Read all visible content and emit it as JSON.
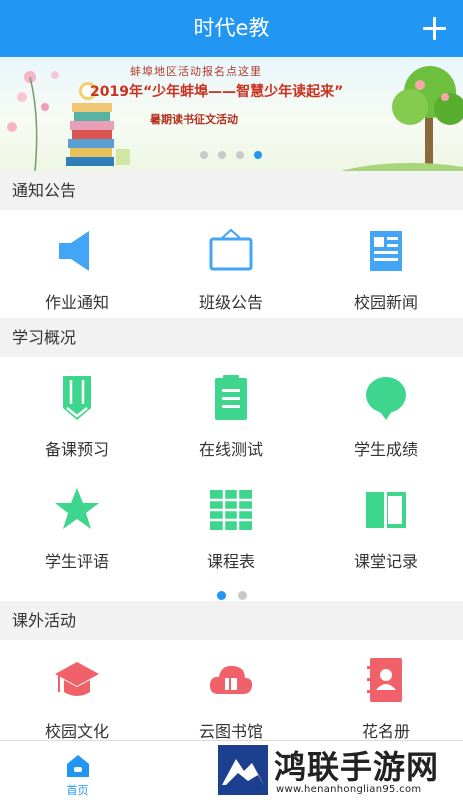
{
  "header": {
    "title": "时代e教"
  },
  "banner": {
    "subtitle": "蚌埠地区活动报名点这里",
    "title": "2019年“少年蚌埠——智慧少年读起来”",
    "caption": "暑期读书征文活动",
    "dots": 4,
    "active_dot": 3
  },
  "sections": {
    "notices": {
      "title": "通知公告",
      "items": [
        {
          "label": "作业通知",
          "icon": "megaphone-icon",
          "color": "#42a5f5"
        },
        {
          "label": "班级公告",
          "icon": "signboard-icon",
          "color": "#42a5f5"
        },
        {
          "label": "校园新闻",
          "icon": "newspaper-icon",
          "color": "#42a5f5"
        }
      ]
    },
    "study": {
      "title": "学习概况",
      "items": [
        {
          "label": "备课预习",
          "icon": "pencil-icon",
          "color": "#3dd68c"
        },
        {
          "label": "在线测试",
          "icon": "clipboard-icon",
          "color": "#3dd68c"
        },
        {
          "label": "学生成绩",
          "icon": "speech-bubble-icon",
          "color": "#3dd68c"
        },
        {
          "label": "学生评语",
          "icon": "star-icon",
          "color": "#3dd68c"
        },
        {
          "label": "课程表",
          "icon": "table-grid-icon",
          "color": "#3dd68c"
        },
        {
          "label": "课堂记录",
          "icon": "book-icon",
          "color": "#3dd68c"
        }
      ],
      "page_dots": 2,
      "active_page": 0
    },
    "activities": {
      "title": "课外活动",
      "items": [
        {
          "label": "校园文化",
          "icon": "graduation-cap-icon",
          "color": "#f0616a"
        },
        {
          "label": "云图书馆",
          "icon": "cloud-book-icon",
          "color": "#f0616a"
        },
        {
          "label": "花名册",
          "icon": "contacts-book-icon",
          "color": "#f0616a"
        }
      ]
    }
  },
  "tabbar": {
    "tabs": [
      {
        "label": "首页",
        "icon": "home-icon",
        "active": true
      }
    ]
  },
  "watermark": {
    "title": "鸿联手游网",
    "url": "www.henanhonglian95.com"
  },
  "colors": {
    "primary": "#2196f3",
    "notice": "#42a5f5",
    "study": "#3dd68c",
    "activity": "#f0616a"
  }
}
